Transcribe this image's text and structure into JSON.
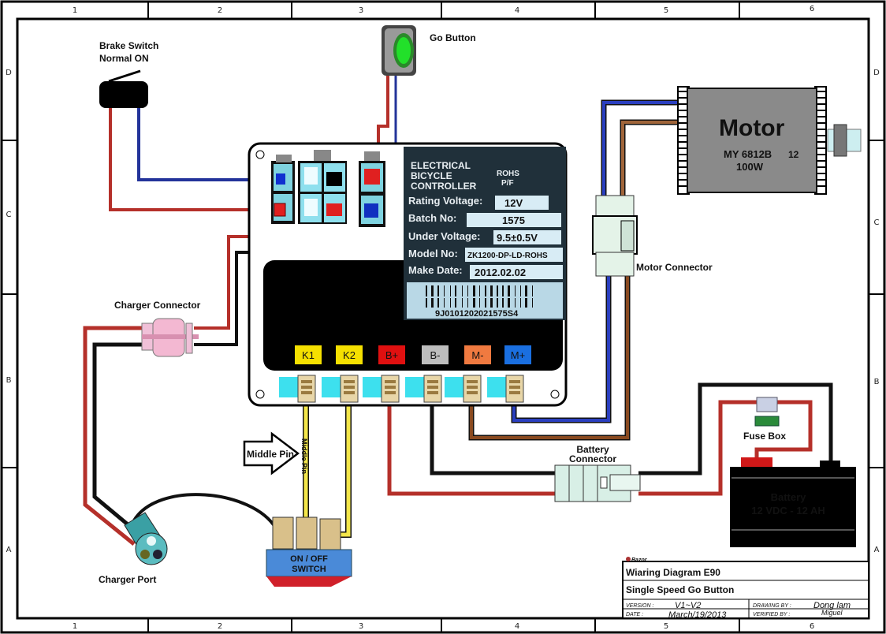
{
  "frame": {
    "columns": [
      "1",
      "2",
      "3",
      "4",
      "5",
      "6"
    ],
    "rows": [
      "D",
      "C",
      "B",
      "A"
    ]
  },
  "components": {
    "brake_switch": {
      "line1": "Brake Switch",
      "line2": "Normal ON"
    },
    "go_button": {
      "label": "Go Button"
    },
    "motor": {
      "title": "Motor",
      "model": "MY 6812B",
      "model_suffix": "12",
      "power": "100W"
    },
    "motor_connector": {
      "label": "Motor Connector"
    },
    "charger_connector": {
      "label": "Charger Connector"
    },
    "charger_port": {
      "label": "Charger Port"
    },
    "middle_pin_arrow": {
      "label": "Middle Pin"
    },
    "middle_pin_wire": {
      "label": "Middle Pin"
    },
    "onoff_switch": {
      "line1": "ON / OFF",
      "line2": "SWITCH"
    },
    "battery_connector": {
      "line1": "Battery",
      "line2": "Connector"
    },
    "fuse_box": {
      "label": "Fuse Box"
    },
    "battery": {
      "line1": "Battery",
      "line2": "12 VDC - 12 AH"
    }
  },
  "controller": {
    "heading": [
      "ELECTRICAL",
      "BICYCLE",
      "CONTROLLER"
    ],
    "rohs": [
      "ROHS",
      "P/F"
    ],
    "fields": [
      {
        "label": "Rating Voltage:",
        "value": "12V"
      },
      {
        "label": "Batch No:",
        "value": "1575"
      },
      {
        "label": "Under Voltage:",
        "value": "9.5±0.5V"
      },
      {
        "label": "Model No:",
        "value": "ZK1200-DP-LD-ROHS"
      },
      {
        "label": "Make Date:",
        "value": "2012.02.02"
      }
    ],
    "barcode_text": "9J0101202021575S4",
    "terminals": [
      {
        "label": "K1",
        "color": "#f5e000"
      },
      {
        "label": "K2",
        "color": "#f5e000"
      },
      {
        "label": "B+",
        "color": "#e01010"
      },
      {
        "label": "B-",
        "color": "#bdbdbd"
      },
      {
        "label": "M-",
        "color": "#f07a40"
      },
      {
        "label": "M+",
        "color": "#1a6fe0"
      }
    ]
  },
  "title_block": {
    "brand": "Razor",
    "title": "Wiaring Diagram E90",
    "subtitle": "Single Speed Go Button",
    "version_label": "VERSION :",
    "version": "V1~V2",
    "drawing_by_label": "DRAWING BY :",
    "drawing_by": "Dong lam",
    "date_label": "DATE :",
    "date": "March/19/2013",
    "verified_by_label": "VERIFIED BY :",
    "verified_by": "Miguel"
  },
  "wire_colors": {
    "red": "#b5302a",
    "black": "#111111",
    "blue": "#23339a",
    "brown": "#8a4a20",
    "yellow": "#f3e64a"
  }
}
